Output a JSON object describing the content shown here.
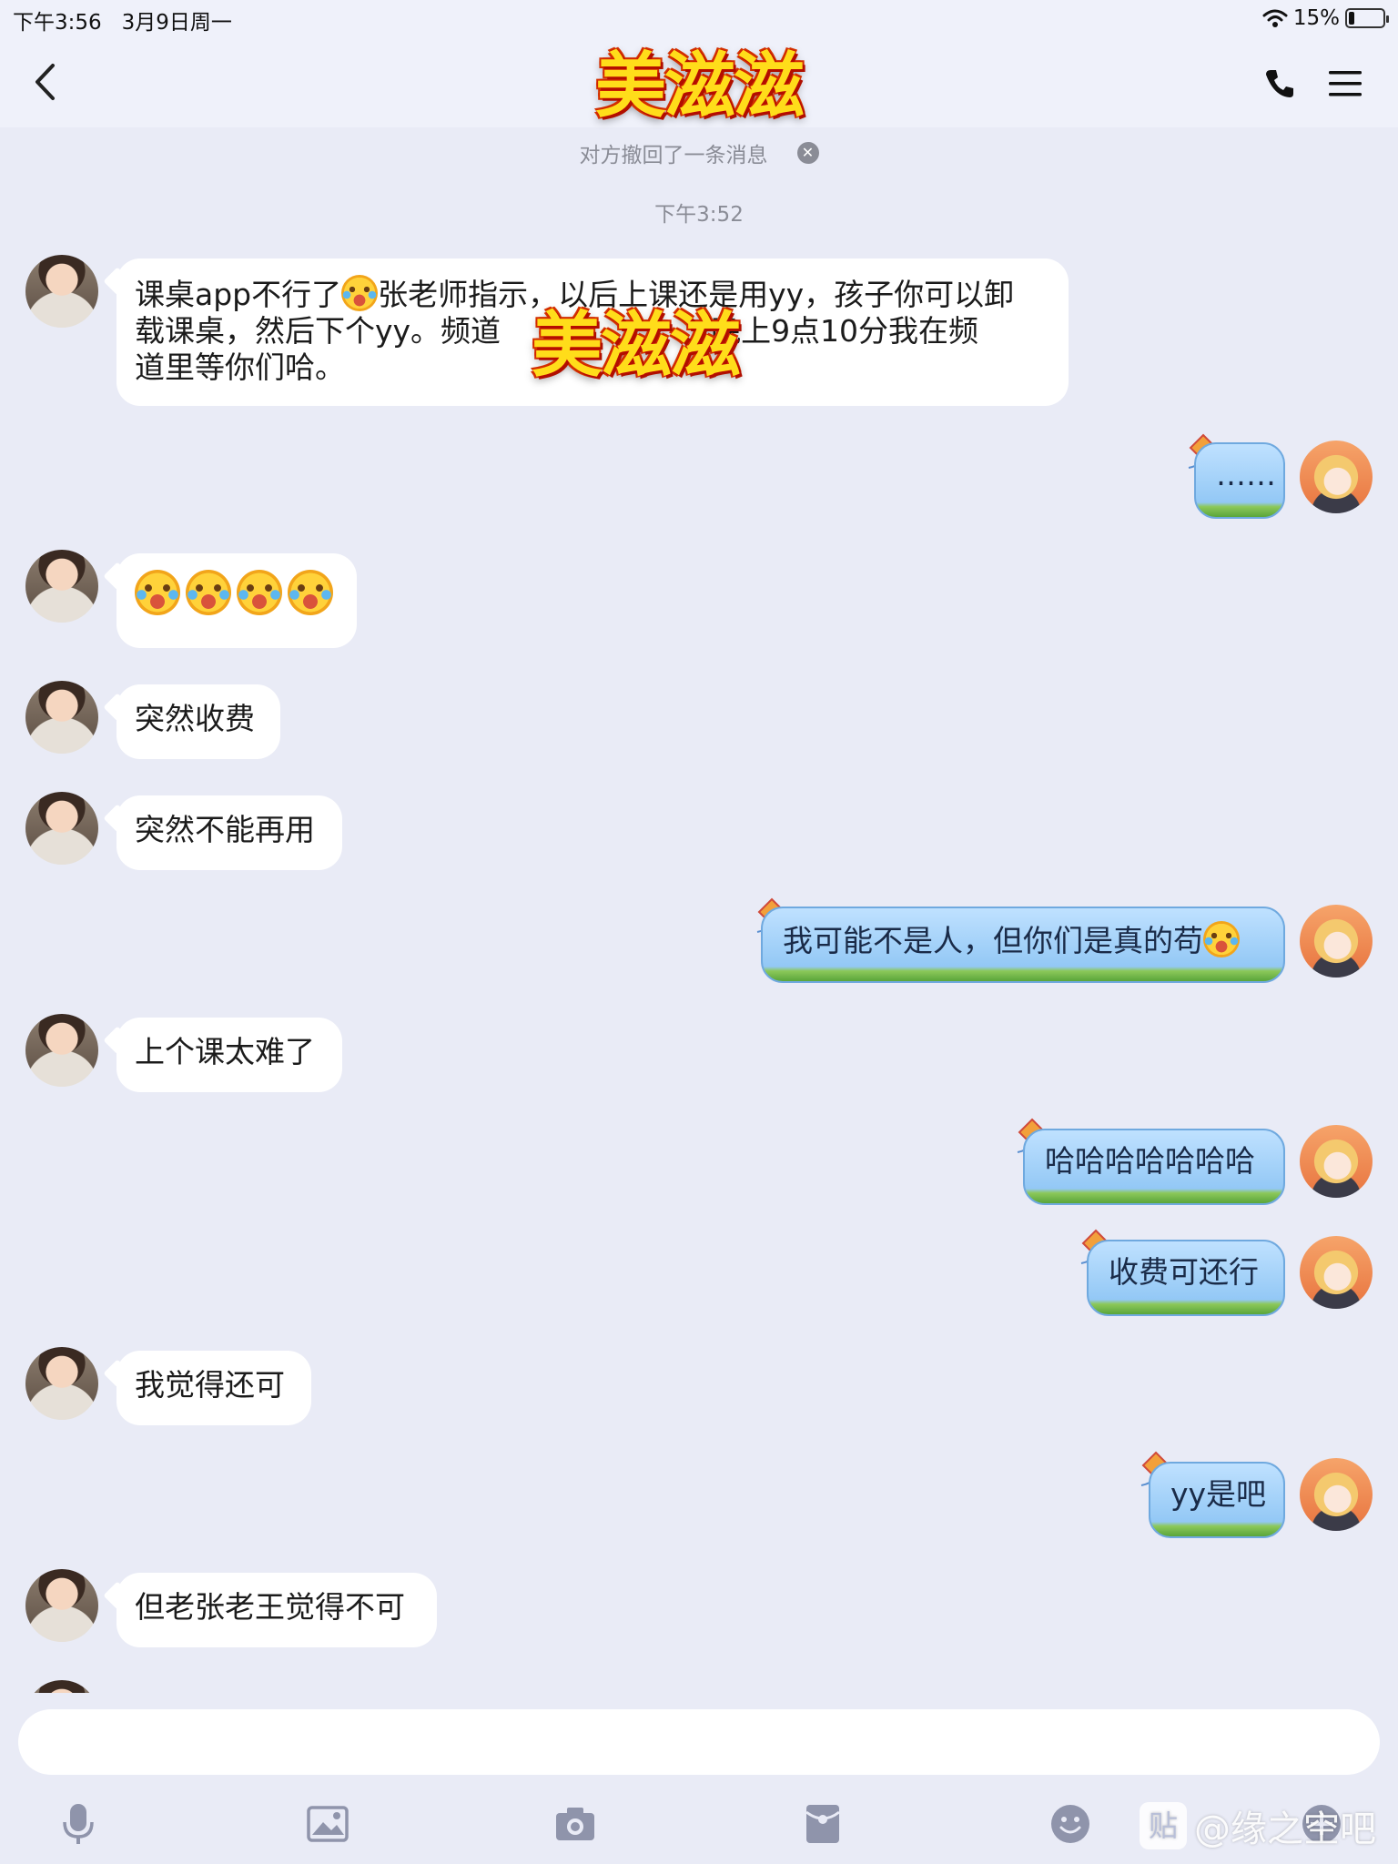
{
  "status_bar": {
    "time_date": "下午3:56   3月9日周一",
    "battery": "15%"
  },
  "header": {
    "title": "美滋滋"
  },
  "notices": {
    "recall": "对方撤回了一条消息",
    "timestamp": "下午3:52"
  },
  "messages": [
    {
      "side": "in",
      "text_a": "课桌app不行了",
      "text_b": "张老师指示，以后上课还是用yy，孩子你可以卸\n载课桌，然后下个yy。频道",
      "text_c": "晚上9点10分我在频\n道里等你们哈。"
    },
    {
      "side": "out",
      "text": "……"
    },
    {
      "side": "in",
      "emoji_count": 4
    },
    {
      "side": "in",
      "text": "突然收费"
    },
    {
      "side": "in",
      "text": "突然不能再用"
    },
    {
      "side": "out",
      "text": "我可能不是人，但你们是真的苟"
    },
    {
      "side": "in",
      "text": "上个课太难了"
    },
    {
      "side": "out",
      "text": "哈哈哈哈哈哈哈"
    },
    {
      "side": "out",
      "text": "收费可还行"
    },
    {
      "side": "in",
      "text": "我觉得还可"
    },
    {
      "side": "out",
      "text": "yy是吧"
    },
    {
      "side": "in",
      "text": "但老张老王觉得不可"
    }
  ],
  "overlay_logo": "美滋滋",
  "input": {
    "placeholder": ""
  },
  "toolbar": [
    "microphone-icon",
    "image-icon",
    "camera-icon",
    "red-packet-icon",
    "emoji-icon",
    "plus-icon"
  ],
  "watermark": {
    "badge": "贴",
    "text": "@缘之空吧"
  },
  "colors": {
    "background": "#e9ebf6",
    "bubble_in": "#ffffff",
    "bubble_out": "#a8d4fa",
    "logo": "#ffdd1a"
  }
}
